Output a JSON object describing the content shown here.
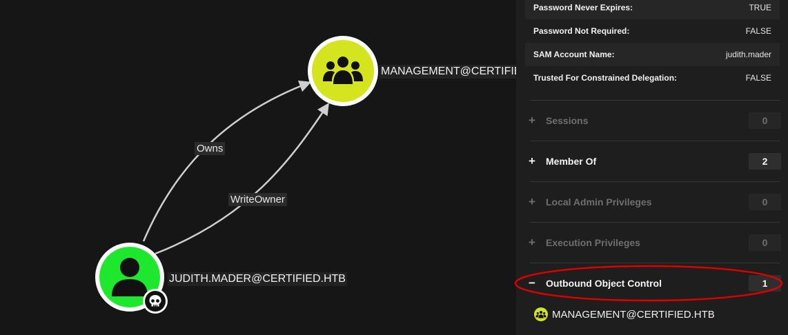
{
  "graph": {
    "nodes": {
      "group": {
        "label": "MANAGEMENT@CERTIFIED.HTB",
        "icon": "group-icon",
        "color": "#d4e41f"
      },
      "user": {
        "label": "JUDITH.MADER@CERTIFIED.HTB",
        "icon": "user-icon",
        "color": "#1ee82d",
        "badge_icon": "skull-icon"
      }
    },
    "edges": [
      {
        "label": "Owns"
      },
      {
        "label": "WriteOwner"
      }
    ]
  },
  "panel": {
    "properties": [
      {
        "key": "Password Never Expires:",
        "value": "TRUE"
      },
      {
        "key": "Password Not Required:",
        "value": "FALSE"
      },
      {
        "key": "SAM Account Name:",
        "value": "judith.mader"
      },
      {
        "key": "Trusted For Constrained Delegation:",
        "value": "FALSE"
      }
    ],
    "sections": [
      {
        "sign": "+",
        "title": "Sessions",
        "count": "0"
      },
      {
        "sign": "+",
        "title": "Member Of",
        "count": "2"
      },
      {
        "sign": "+",
        "title": "Local Admin Privileges",
        "count": "0"
      },
      {
        "sign": "+",
        "title": "Execution Privileges",
        "count": "0"
      },
      {
        "sign": "−",
        "title": "Outbound Object Control",
        "count": "1"
      }
    ],
    "outbound_results": [
      {
        "label": "MANAGEMENT@CERTIFIED.HTB",
        "icon": "group-icon"
      }
    ]
  },
  "colors": {
    "background": "#161616",
    "panel": "#1e1e1e",
    "group_node": "#d4e41f",
    "user_node": "#1ee82d",
    "highlight_ring": "#e00000"
  }
}
